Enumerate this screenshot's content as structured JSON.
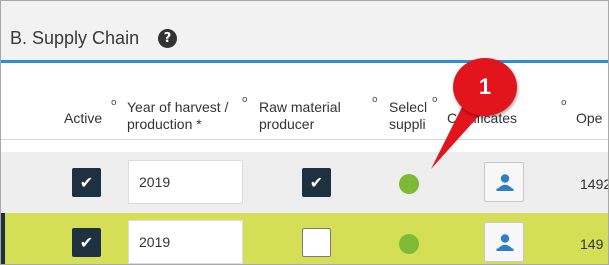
{
  "section": {
    "title": "B. Supply Chain",
    "help_icon": "?"
  },
  "columns": {
    "active": "Active",
    "year_line1": "Year of harvest /",
    "year_line2": "production *",
    "raw_line1": "Raw material",
    "raw_line2": "producer",
    "select_line1": "Selecl",
    "select_line2": "suppli",
    "certificates": "Certificates",
    "operator": "Ope",
    "info_icon": "o"
  },
  "rows": [
    {
      "active": true,
      "year": "2019",
      "raw_material_producer": true,
      "status": "green",
      "id_cut": "1492"
    },
    {
      "active": true,
      "year": "2019",
      "raw_material_producer": false,
      "status": "green",
      "id_cut": "149"
    }
  ],
  "callout": {
    "number": "1"
  },
  "icons": {
    "checkmark": "✔",
    "certificate_icon": "user-card-icon"
  },
  "colors": {
    "accent": "#2c8fd6",
    "highlight_row": "#d4df56",
    "check": "#1d3140",
    "status_green": "#7dbb34",
    "callout": "#e2141c"
  }
}
